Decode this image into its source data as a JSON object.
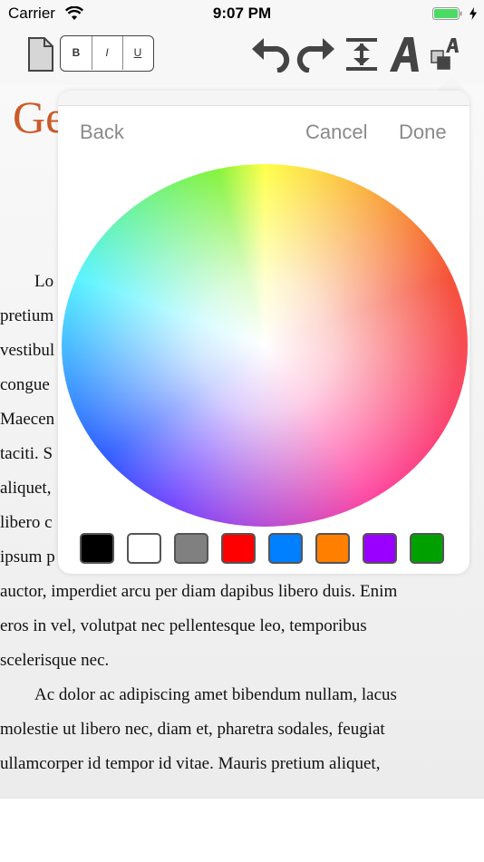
{
  "status_bar": {
    "carrier": "Carrier",
    "time": "9:07 PM",
    "icons": [
      "wifi-icon",
      "battery-icon",
      "charging-icon"
    ]
  },
  "toolbar": {
    "bold_label": "B",
    "italic_label": "I",
    "underline_label": "U",
    "icons": [
      "document-icon",
      "undo-icon",
      "redo-icon",
      "line-spacing-icon",
      "font-icon",
      "text-color-icon"
    ]
  },
  "document": {
    "heading": "Ge",
    "lines": [
      "Lo",
      "pretium",
      "vestibul",
      "congue",
      "Maecen",
      "taciti. S",
      "aliquet,",
      "libero c",
      "ipsum p",
      "auctor, imperdiet arcu per diam dapibus libero duis. Enim",
      "eros in vel, volutpat nec pellentesque leo, temporibus",
      "scelerisque nec.",
      "Ac dolor ac adipiscing amet bibendum nullam, lacus",
      "molestie ut libero nec, diam et, pharetra sodales, feugiat",
      "ullamcorper id tempor id vitae. Mauris pretium aliquet,"
    ],
    "indent_lines": [
      0,
      12
    ],
    "accent_color": "#cc5a29"
  },
  "color_picker": {
    "back_label": "Back",
    "cancel_label": "Cancel",
    "done_label": "Done",
    "swatches": [
      {
        "name": "black",
        "color": "#000000"
      },
      {
        "name": "white",
        "color": "#ffffff"
      },
      {
        "name": "gray",
        "color": "#808080"
      },
      {
        "name": "red",
        "color": "#ff0000"
      },
      {
        "name": "blue",
        "color": "#007fff"
      },
      {
        "name": "orange",
        "color": "#ff7f00"
      },
      {
        "name": "purple",
        "color": "#9900ff"
      },
      {
        "name": "green",
        "color": "#00a000"
      }
    ]
  }
}
